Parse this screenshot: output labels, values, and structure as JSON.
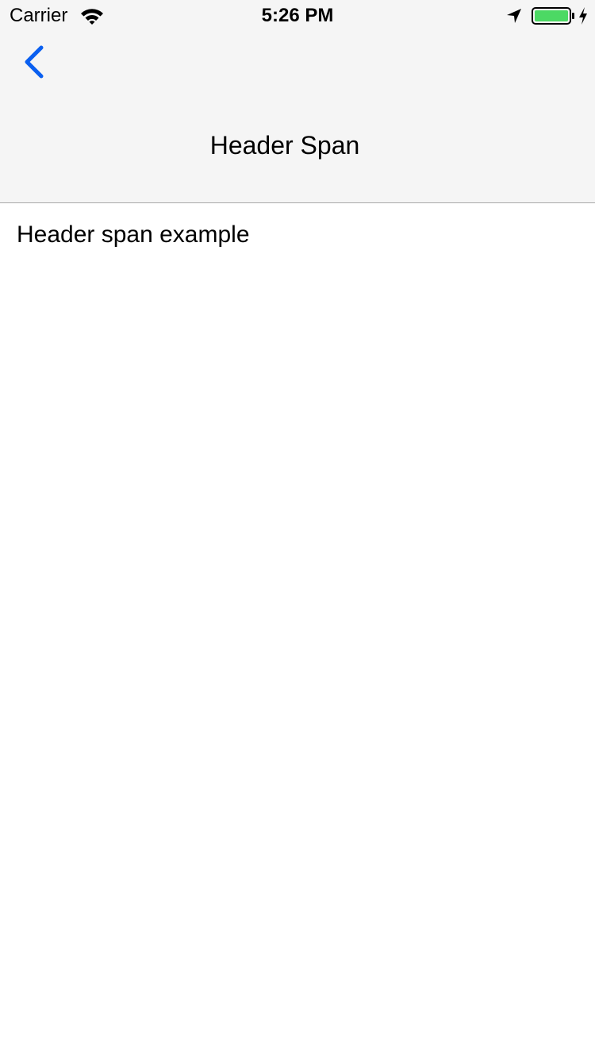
{
  "status_bar": {
    "carrier": "Carrier",
    "time": "5:26 PM",
    "battery_color": "#4cd964"
  },
  "nav": {
    "back_icon": "chevron-left-icon",
    "back_color": "#0a5ff0",
    "title": "Header Span",
    "background": "#f5f5f5"
  },
  "content": {
    "text": "Header span example"
  }
}
